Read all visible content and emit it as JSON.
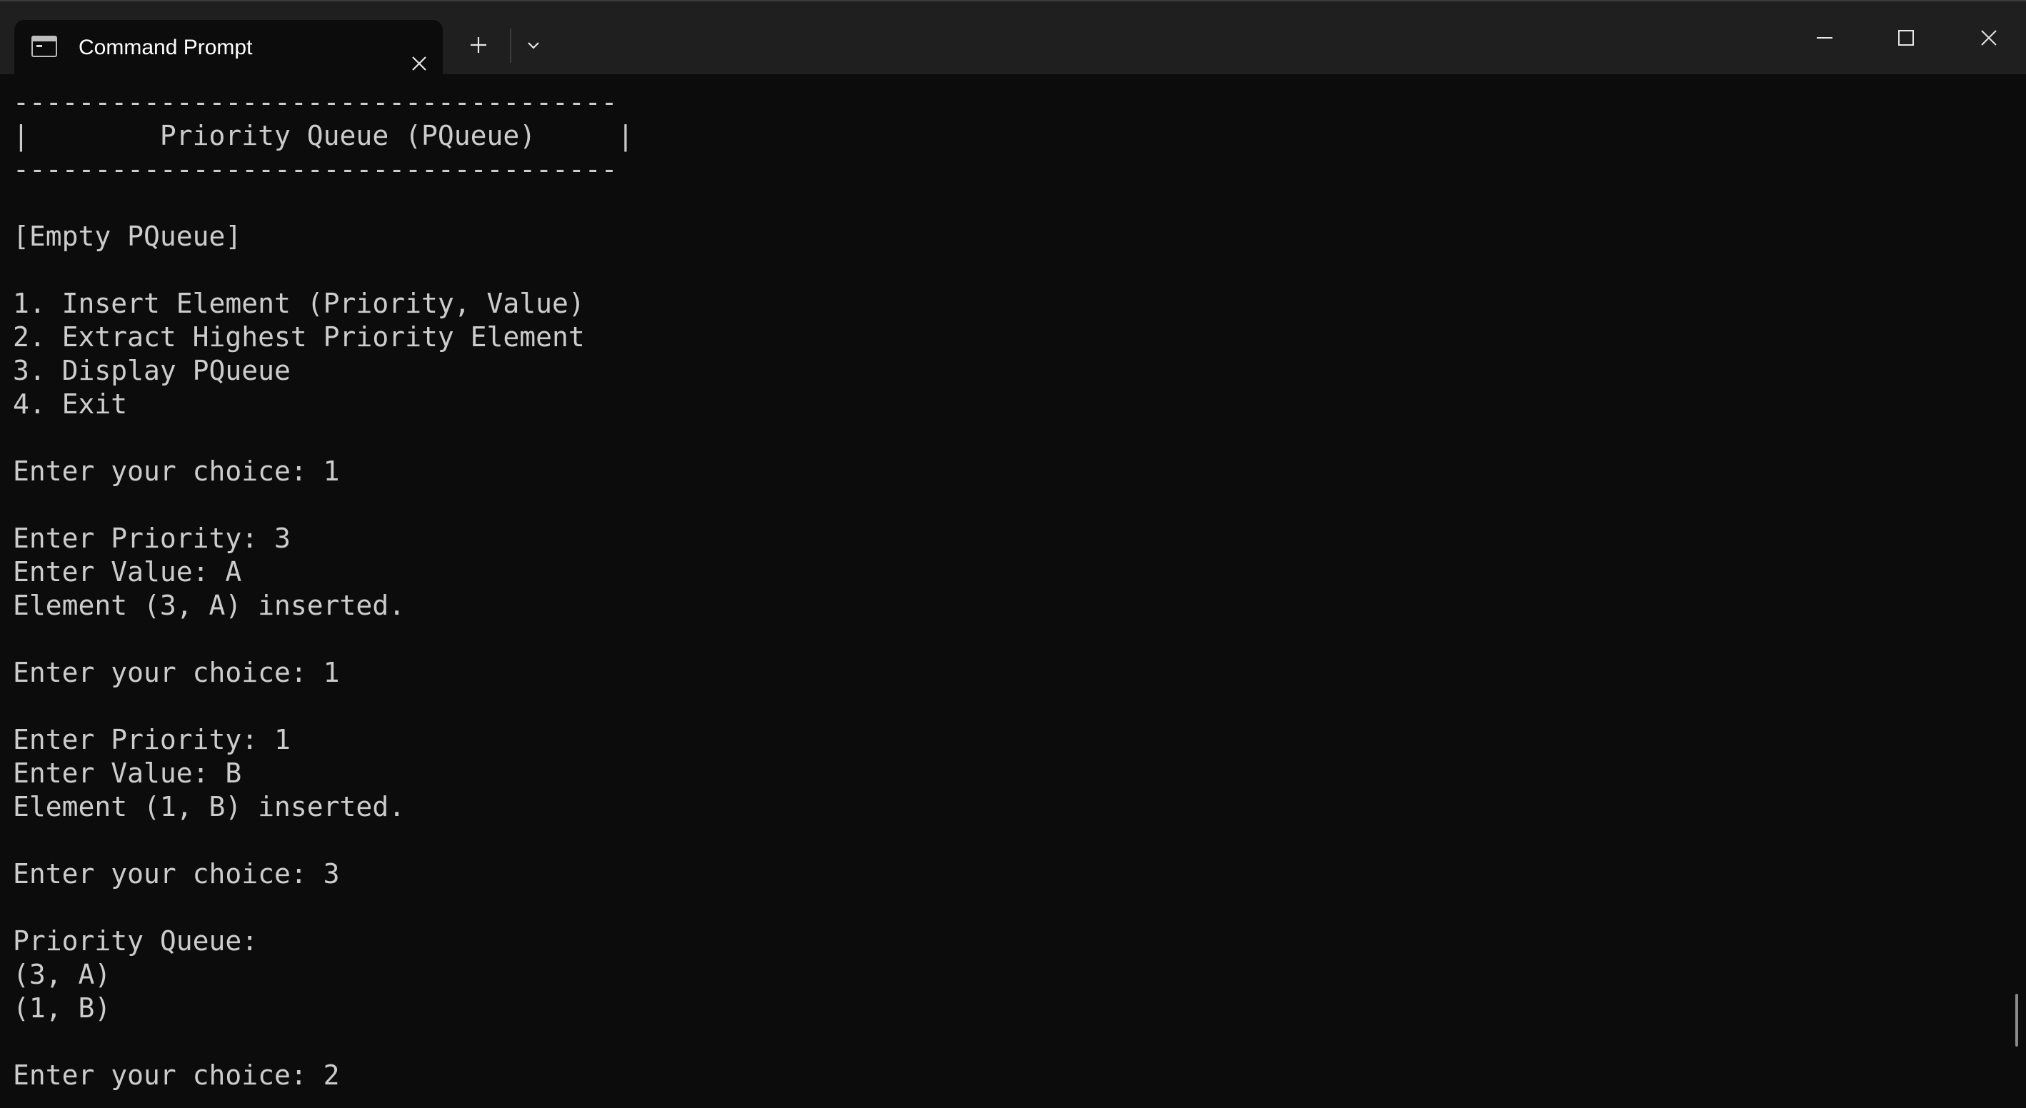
{
  "window": {
    "tab_title": "Command Prompt",
    "tab_icon": "cmd-icon",
    "buttons": {
      "tab_close": "close-icon",
      "new_tab": "plus-icon",
      "dropdown": "chevron-down-icon",
      "minimize": "minimize-icon",
      "maximize": "maximize-icon",
      "close": "close-icon"
    }
  },
  "console": {
    "lines": [
      "-------------------------------------",
      "|        Priority Queue (PQueue)     |",
      "-------------------------------------",
      "",
      "[Empty PQueue]",
      "",
      "1. Insert Element (Priority, Value)",
      "2. Extract Highest Priority Element",
      "3. Display PQueue",
      "4. Exit",
      "",
      "Enter your choice: 1",
      "",
      "Enter Priority: 3",
      "Enter Value: A",
      "Element (3, A) inserted.",
      "",
      "Enter your choice: 1",
      "",
      "Enter Priority: 1",
      "Enter Value: B",
      "Element (1, B) inserted.",
      "",
      "Enter your choice: 3",
      "",
      "Priority Queue:",
      "(3, A)",
      "(1, B)",
      "",
      "Enter your choice: 2"
    ]
  },
  "colors": {
    "background": "#0c0c0c",
    "titlebar": "#1f1f1f",
    "text": "#cccccc",
    "tab_text": "#ffffff"
  }
}
